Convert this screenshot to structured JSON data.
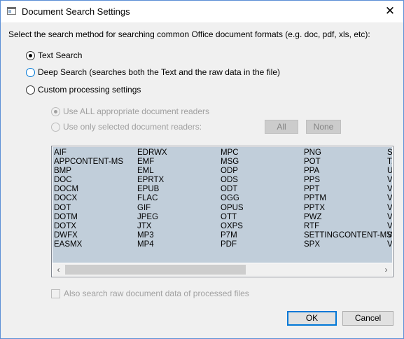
{
  "window": {
    "title": "Document Search Settings",
    "close_glyph": "✕"
  },
  "prompt": "Select the search method for searching common Office document formats (e.g. doc, pdf, xls, etc):",
  "methods": [
    {
      "label": "Text Search",
      "checked": true
    },
    {
      "label": "Deep Search (searches both the Text and the raw data in the file)",
      "checked": false
    },
    {
      "label": "Custom processing settings",
      "checked": false
    }
  ],
  "readers": {
    "all_label": "Use ALL appropriate document readers",
    "selected_label": "Use only selected document readers:",
    "all_button": "All",
    "none_button": "None"
  },
  "formats_columns": [
    [
      "AIF",
      "APPCONTENT-MS",
      "BMP",
      "DOC",
      "DOCM",
      "DOCX",
      "DOT",
      "DOTM",
      "DOTX",
      "DWFX",
      "EASMX"
    ],
    [
      "EDRWX",
      "EMF",
      "EML",
      "EPRTX",
      "EPUB",
      "FLAC",
      "GIF",
      "JPEG",
      "JTX",
      "MP3",
      "MP4"
    ],
    [
      "MPC",
      "MSG",
      "ODP",
      "ODS",
      "ODT",
      "OGG",
      "OPUS",
      "OTT",
      "OXPS",
      "P7M",
      "PDF"
    ],
    [
      "PNG",
      "POT",
      "PPA",
      "PPS",
      "PPT",
      "PPTM",
      "PPTX",
      "PWZ",
      "RTF",
      "SETTINGCONTENT-MS",
      "SPX"
    ],
    [
      "SI",
      "T.",
      "U",
      "VI",
      "VI",
      "V:",
      "V:",
      "V:",
      "V:",
      "V:",
      "V:"
    ]
  ],
  "scroll": {
    "left_arrow": "‹",
    "right_arrow": "›"
  },
  "raw_data_label": "Also search raw document data of processed files",
  "buttons": {
    "ok": "OK",
    "cancel": "Cancel"
  }
}
